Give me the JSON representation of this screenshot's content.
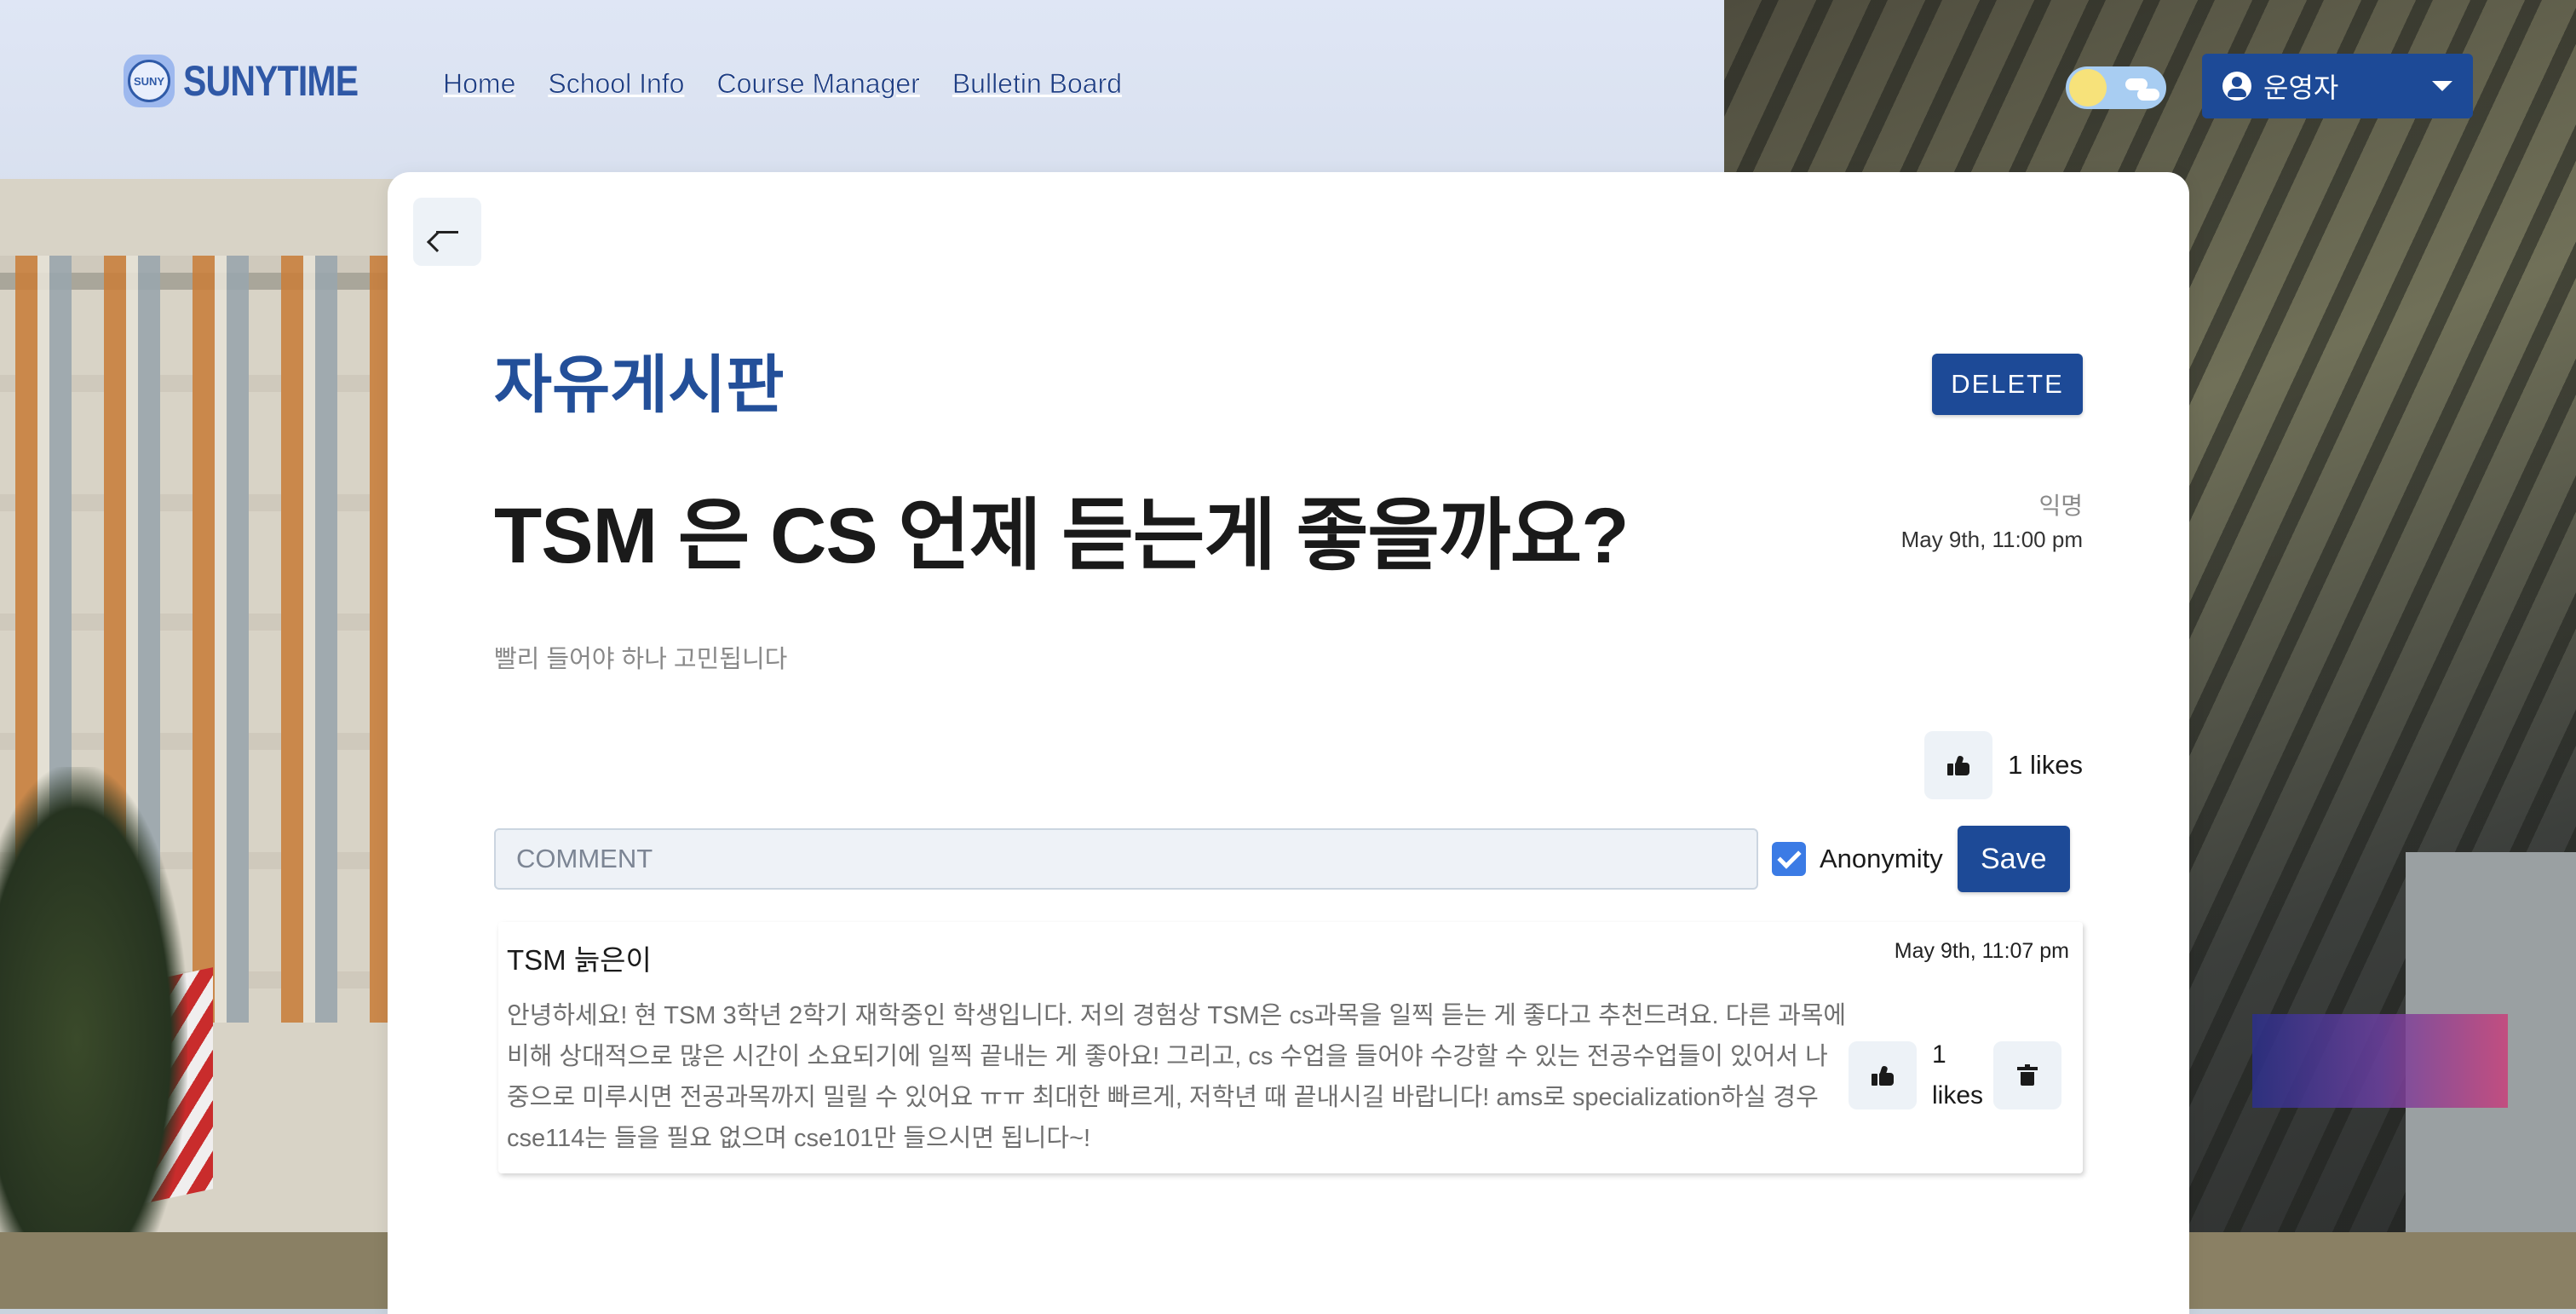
{
  "header": {
    "logo_text": "SUNYTIME",
    "logo_badge_text": "SUNY",
    "nav": [
      "Home",
      "School Info",
      "Course Manager",
      "Bulletin Board"
    ],
    "theme_toggle": "light",
    "user_name": "운영자"
  },
  "post": {
    "board_title": "자유게시판",
    "delete_label": "DELETE",
    "title": "TSM 은 CS 언제 듣는게 좋을까요?",
    "author": "익명",
    "date": "May 9th, 11:00 pm",
    "body": "빨리 들어야 하나 고민됩니다",
    "likes": "1 likes"
  },
  "comment_form": {
    "placeholder": "COMMENT",
    "anonymity_label": "Anonymity",
    "anonymity_checked": true,
    "save_label": "Save"
  },
  "comments": [
    {
      "author": "TSM 늙은이",
      "date": "May 9th, 11:07 pm",
      "text": "안녕하세요! 현 TSM 3학년 2학기 재학중인 학생입니다. 저의 경험상 TSM은 cs과목을 일찍 듣는 게 좋다고 추천드려요. 다른 과목에 비해 상대적으로 많은 시간이 소요되기에 일찍 끝내는 게 좋아요! 그리고, cs 수업을 들어야 수강할 수 있는 전공수업들이 있어서 나중으로 미루시면 전공과목까지 밀릴 수 있어요 ㅠㅠ 최대한 빠르게, 저학년 때 끝내시길 바랍니다! ams로 specialization하실 경우 cse114는 들을 필요 없으며 cse101만 들으시면 됩니다~!",
      "likes": "1 likes"
    }
  ],
  "colors": {
    "accent": "#1d4a97",
    "title_blue": "#234f99",
    "checkbox": "#3b7be5"
  }
}
